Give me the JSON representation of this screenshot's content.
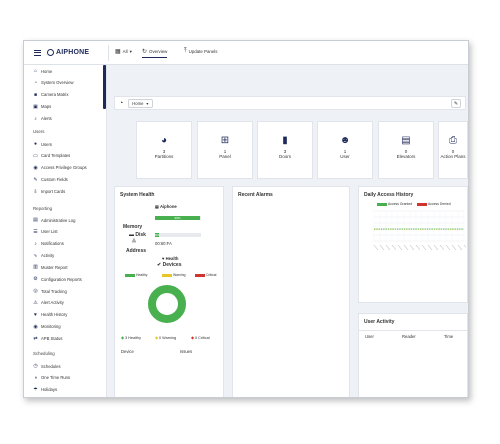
{
  "app": {
    "logo_text": "AIPHONE"
  },
  "topbar": {
    "building_select": "All",
    "tabs": [
      {
        "label": "Overview",
        "icon": "refresh-icon"
      },
      {
        "label": "Update Panels",
        "icon": "upload-icon"
      }
    ]
  },
  "sidebar": {
    "top": [
      {
        "label": "Home",
        "icon": "home-icon"
      },
      {
        "label": "System Overview",
        "icon": "gauge-icon"
      },
      {
        "label": "Camera Matrix",
        "icon": "camera-icon"
      },
      {
        "label": "Maps",
        "icon": "map-icon"
      },
      {
        "label": "Alerts",
        "icon": "bell-icon"
      }
    ],
    "users_heading": "Users",
    "users": [
      {
        "label": "Users",
        "icon": "user-icon"
      },
      {
        "label": "Card Templates",
        "icon": "card-icon"
      },
      {
        "label": "Access Privilege Groups",
        "icon": "group-icon"
      },
      {
        "label": "Custom Fields",
        "icon": "pencil-icon"
      },
      {
        "label": "Import Cards",
        "icon": "import-icon"
      }
    ],
    "reporting_heading": "Reporting",
    "reporting": [
      {
        "label": "Administrative Log",
        "icon": "log-icon"
      },
      {
        "label": "User List",
        "icon": "list-icon"
      },
      {
        "label": "Notifications",
        "icon": "bell-icon"
      },
      {
        "label": "Activity",
        "icon": "activity-icon"
      },
      {
        "label": "Muster Report",
        "icon": "muster-icon"
      },
      {
        "label": "Configuration Reports",
        "icon": "config-icon"
      },
      {
        "label": "Total Tracking",
        "icon": "tracking-icon"
      },
      {
        "label": "Alert Activity",
        "icon": "alert-activity-icon"
      },
      {
        "label": "Health History",
        "icon": "health-icon"
      },
      {
        "label": "Monitoring",
        "icon": "eye-icon"
      },
      {
        "label": "APB Status",
        "icon": "apb-icon"
      }
    ],
    "scheduling_heading": "Scheduling",
    "scheduling": [
      {
        "label": "Schedules",
        "icon": "clock-icon"
      },
      {
        "label": "One Time Runs",
        "icon": "run-icon"
      },
      {
        "label": "Holidays",
        "icon": "holiday-icon"
      }
    ]
  },
  "toolbar": {
    "view_select": "Home"
  },
  "cards": [
    {
      "count": "3",
      "label": "Partitions",
      "icon": "pie-icon"
    },
    {
      "count": "1",
      "label": "Panel",
      "icon": "network-icon"
    },
    {
      "count": "3",
      "label": "Doors",
      "icon": "door-icon"
    },
    {
      "count": "1",
      "label": "User",
      "icon": "users-icon"
    },
    {
      "count": "0",
      "label": "Elevators",
      "icon": "elevator-icon"
    },
    {
      "count": "0",
      "label": "Action Plans",
      "icon": "scroll-icon"
    }
  ],
  "system_health": {
    "title": "System Health",
    "panel_name": "Aiphone",
    "memory_label": "Memory",
    "memory_pct": 0.98,
    "disk_label": "Disk",
    "disk_pct": 0.08,
    "address_label": "Address",
    "address_value": "00:60:FA",
    "devices_heading1": "Health",
    "devices_heading2": "Devices",
    "legend": [
      {
        "label": "Healthy",
        "color": "#48b04e"
      },
      {
        "label": "Warning",
        "color": "#e8c62a"
      },
      {
        "label": "Critical",
        "color": "#d0342c"
      }
    ],
    "donut_healthy": 3,
    "donut_warning": 0,
    "donut_critical": 0,
    "summary": [
      {
        "label": "3 Healthy",
        "color": "#48b04e"
      },
      {
        "label": "0 Warning",
        "color": "#e8c62a"
      },
      {
        "label": "0 Critical",
        "color": "#d0342c"
      }
    ],
    "col_device": "Device",
    "col_issues": "Issues"
  },
  "recent_alarms": {
    "title": "Recent Alarms"
  },
  "daily_access": {
    "title": "Daily Access History",
    "legend": [
      {
        "label": "Access Granted",
        "color": "#48b04e"
      },
      {
        "label": "Access Denied",
        "color": "#d0342c"
      }
    ]
  },
  "user_activity": {
    "title": "User Activity",
    "cols": [
      "User",
      "Reader",
      "Time"
    ]
  },
  "colors": {
    "brand": "#1d2a5a",
    "healthy": "#48b04e",
    "warning": "#e8c62a",
    "critical": "#d0342c"
  }
}
